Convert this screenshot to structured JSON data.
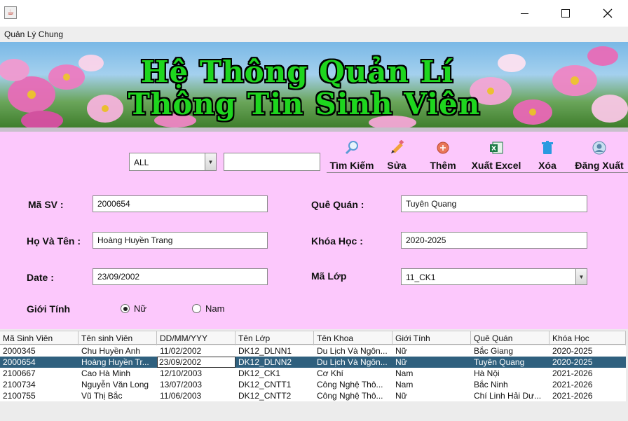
{
  "window": {
    "app_icon": "java-icon",
    "controls": [
      "minimize-icon",
      "maximize-icon",
      "close-icon"
    ]
  },
  "menu": {
    "items": [
      {
        "label": "Quản Lý Chung"
      }
    ]
  },
  "banner": {
    "line1": "Hệ Thông Quản Lí",
    "line2": "Thông Tin Sinh Viên",
    "title_color": "#1ed61e"
  },
  "search": {
    "filter_value": "ALL",
    "query": ""
  },
  "toolbar": {
    "search_label": "Tìm Kiếm",
    "edit_label": "Sửa",
    "add_label": "Thêm",
    "export_label": "Xuất Excel",
    "delete_label": "Xóa",
    "logout_label": "Đăng Xuất"
  },
  "form": {
    "student_id_label": "Mã SV :",
    "student_id_value": "2000654",
    "name_label": "Họ Và Tên :",
    "name_value": "Hoàng Huyền Trang",
    "date_label": "Date :",
    "date_value": "23/09/2002",
    "gender_label": "Giới Tính",
    "gender_female": "Nữ",
    "gender_male": "Nam",
    "gender_selected": "Nữ",
    "hometown_label": "Quê Quán :",
    "hometown_value": "Tuyên Quang",
    "course_label": "Khóa Học :",
    "course_value": "2020-2025",
    "class_label": "Mã Lớp",
    "class_value": "11_CK1"
  },
  "table": {
    "columns": [
      "Mã Sinh Viên",
      "Tên sinh Viên",
      "DD/MM/YYY",
      "Tên Lớp",
      "Tên Khoa",
      "Giới Tính",
      "Quê Quán",
      "Khóa Học"
    ],
    "rows": [
      [
        "2000345",
        "Chu Huyền Anh",
        "11/02/2002",
        "DK12_DLNN1",
        "Du Lịch Và Ngôn...",
        "Nữ",
        "Bắc Giang",
        "2020-2025"
      ],
      [
        "2000654",
        "Hoàng Huyền Tr...",
        "23/09/2002",
        "DK12_DLNN2",
        "Du Lịch Và Ngôn...",
        "Nữ",
        "Tuyên Quang",
        "2020-2025"
      ],
      [
        "2100667",
        "Cao Hà Minh",
        "12/10/2003",
        "DK12_CK1",
        "Cơ Khí",
        "Nam",
        "Hà Nội",
        "2021-2026"
      ],
      [
        "2100734",
        "Nguyễn Văn Long",
        "13/07/2003",
        "DK12_CNTT1",
        "Công Nghệ Thô...",
        "Nam",
        "Bắc Ninh",
        "2021-2026"
      ],
      [
        "2100755",
        "Vũ Thị Bắc",
        "11/06/2003",
        "DK12_CNTT2",
        "Công Nghệ Thô...",
        "Nữ",
        "Chí Linh Hải Dư...",
        "2021-2026"
      ]
    ],
    "selected_row": 1
  },
  "colors": {
    "panel_bg": "#fcc8fc",
    "selected_row_bg": "#2f607e"
  }
}
